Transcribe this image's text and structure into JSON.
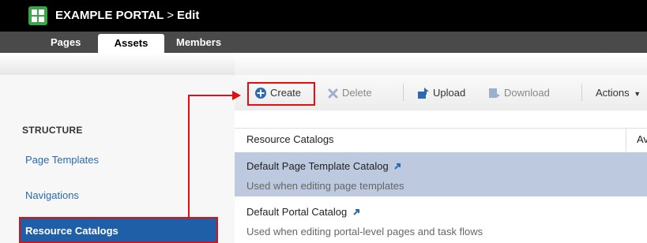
{
  "header": {
    "portal_name": "EXAMPLE PORTAL",
    "separator": ">",
    "mode": "Edit"
  },
  "tabs": [
    {
      "label": "Pages"
    },
    {
      "label": "Assets"
    },
    {
      "label": "Members"
    }
  ],
  "toolbar": {
    "create_label": "Create",
    "delete_label": "Delete",
    "upload_label": "Upload",
    "download_label": "Download",
    "actions_label": "Actions"
  },
  "sidebar": {
    "section_title": "STRUCTURE",
    "items": [
      {
        "label": "Page Templates"
      },
      {
        "label": "Navigations"
      },
      {
        "label": "Resource Catalogs"
      }
    ]
  },
  "table": {
    "columns": [
      "Resource Catalogs",
      "Av"
    ],
    "rows": [
      {
        "title": "Default Page Template Catalog",
        "description": "Used when editing page templates"
      },
      {
        "title": "Default Portal Catalog",
        "description": "Used when editing portal-level pages and task flows"
      }
    ]
  },
  "colors": {
    "accent": "#1f5fa8",
    "selected_row": "#bcc9de",
    "annotation": "#e01010"
  }
}
